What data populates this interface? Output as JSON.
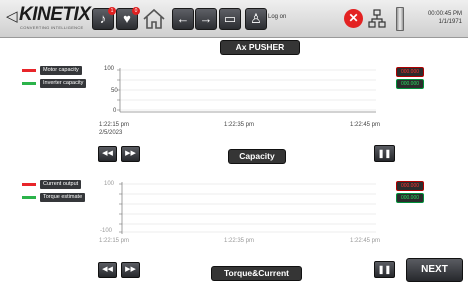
{
  "header": {
    "brand": "KINETIX",
    "brand_tagline": "CONVERTING INTELLIGENCE",
    "login_label": "Log on",
    "clock_time": "00:00:45 PM",
    "clock_date": "1/1/1971",
    "alarm_badge_1": "1",
    "alarm_badge_2": "0"
  },
  "page": {
    "title": "Ax PUSHER",
    "next_label": "NEXT"
  },
  "chart1": {
    "title": "Capacity",
    "legend": [
      {
        "label": "Motor capacity",
        "color": "#e8252a"
      },
      {
        "label": "Inverter capacity",
        "color": "#2bb34a"
      }
    ],
    "values": [
      "000.000",
      "000.000"
    ],
    "y_ticks": [
      "100",
      "50",
      "0"
    ],
    "x_ticks": [
      "1:22:15 pm",
      "1:22:35 pm",
      "1:22:45 pm"
    ],
    "x_date": "2/5/2023"
  },
  "chart2": {
    "title": "Torque&Current",
    "legend": [
      {
        "label": "Current output",
        "color": "#e8252a"
      },
      {
        "label": "Torque estimate",
        "color": "#2bb34a"
      }
    ],
    "values": [
      "000.000",
      "000.000"
    ],
    "y_ticks": [
      "100",
      "-100"
    ],
    "x_ticks": [
      "1:22:15 pm",
      "1:22:35 pm",
      "1:22:45 pm"
    ]
  },
  "chart_data": [
    {
      "type": "line",
      "title": "Capacity",
      "series": [
        {
          "name": "Motor capacity",
          "values": []
        },
        {
          "name": "Inverter capacity",
          "values": []
        }
      ],
      "x": [
        "1:22:15 pm",
        "1:22:35 pm",
        "1:22:45 pm"
      ],
      "ylim": [
        0,
        100
      ],
      "grid": true
    },
    {
      "type": "line",
      "title": "Torque&Current",
      "series": [
        {
          "name": "Current output",
          "values": []
        },
        {
          "name": "Torque estimate",
          "values": []
        }
      ],
      "x": [
        "1:22:15 pm",
        "1:22:35 pm",
        "1:22:45 pm"
      ],
      "ylim": [
        -100,
        100
      ],
      "grid": true
    }
  ],
  "colors": {
    "accent_red": "#e8252a",
    "accent_green": "#2bb34a",
    "label_dark": "#35373a"
  }
}
